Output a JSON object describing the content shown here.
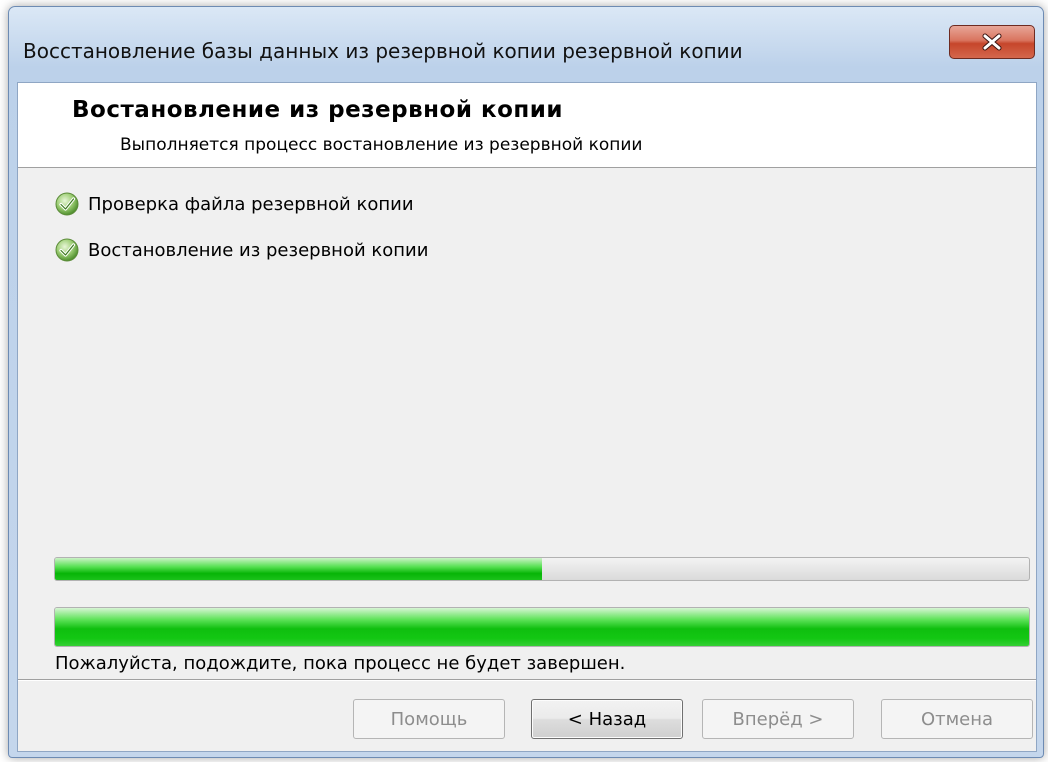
{
  "window": {
    "title": "Восстановление базы данных из резервной копии резервной копии"
  },
  "header": {
    "title": "Востановление из резервной копии",
    "subtitle": "Выполняется процесс востановление из резервной копии"
  },
  "steps": [
    {
      "label": "Проверка файла резервной копии",
      "icon": "check-icon",
      "status": "done"
    },
    {
      "label": "Востановление из резервной копии",
      "icon": "check-icon",
      "status": "done"
    }
  ],
  "progress": {
    "current_step_fraction": 0.5,
    "overall_fraction": 1.0,
    "status_text": "Пожалуйста, подождите, пока процесс не будет завершен."
  },
  "buttons": {
    "help": "Помощь",
    "back": "< Назад",
    "next": "Вперёд >",
    "cancel": "Отмена"
  },
  "colors": {
    "progress_green": "#0fbf0f",
    "close_red": "#c6462b"
  }
}
